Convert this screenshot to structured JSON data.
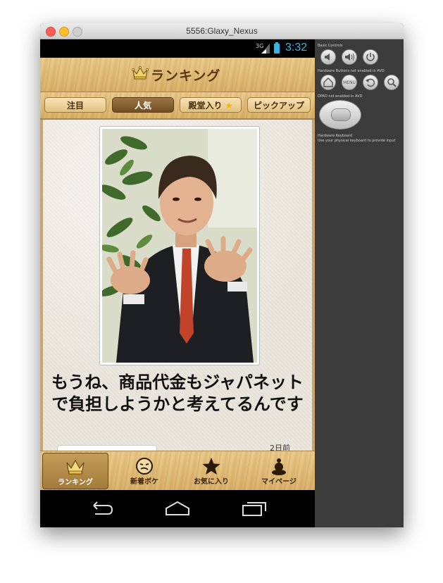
{
  "window": {
    "title": "5556:Glaxy_Nexus"
  },
  "statusbar": {
    "network": "3G",
    "time": "3:32"
  },
  "appbar": {
    "title": "ランキング"
  },
  "tabs": [
    {
      "label": "注目",
      "active": false
    },
    {
      "label": "人気",
      "active": true
    },
    {
      "label": "殿堂入り",
      "star": "★",
      "active": false
    },
    {
      "label": "ピックアップ",
      "active": false
    }
  ],
  "post": {
    "caption": "もうね、商品代金もジャパネットで負担しようかと考えてるんです",
    "time_ago": "2日前"
  },
  "bottomnav": [
    {
      "label": "ランキング",
      "icon": "crown-icon",
      "active": true
    },
    {
      "label": "新着ボケ",
      "icon": "face-icon",
      "active": false
    },
    {
      "label": "お気に入り",
      "icon": "star-icon",
      "active": false
    },
    {
      "label": "マイページ",
      "icon": "person-icon",
      "active": false
    }
  ],
  "controls": {
    "basic_title": "Basic Controls",
    "hardware_title": "Hardware Buttons not enabled in AVD",
    "menu_label": "MENU",
    "dpad_title": "DPAD not enabled in AVD",
    "keyboard_title": "Hardware Keyboard",
    "keyboard_sub": "Use your physical keyboard to provide input"
  },
  "colors": {
    "accent": "#33b5e5",
    "active_tab": "#7a5a2e",
    "wood": "#dfbb78"
  }
}
